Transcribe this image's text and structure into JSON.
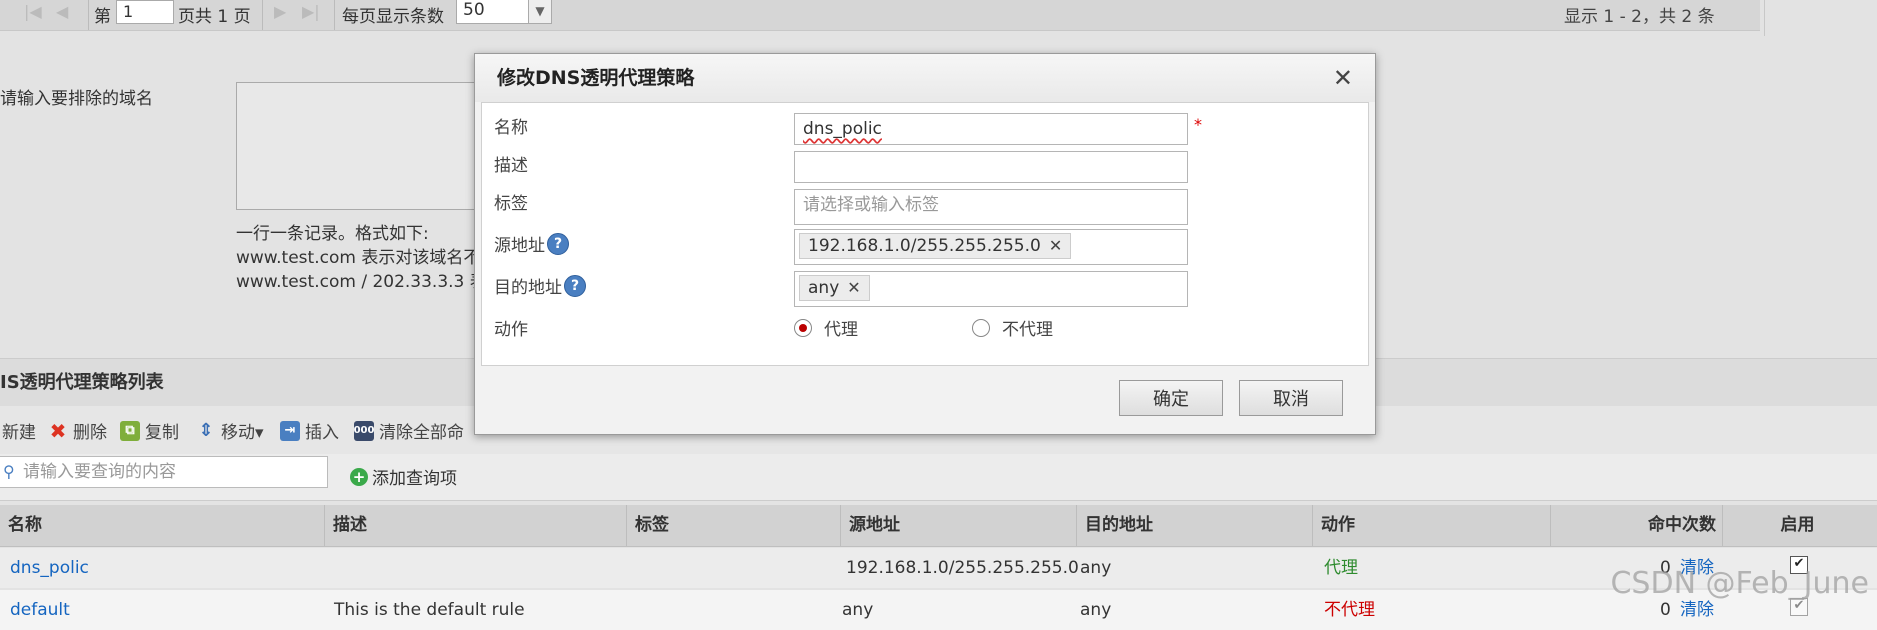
{
  "pager": {
    "first_icon": "first-page-icon",
    "prev_icon": "prev-page-icon",
    "page_prefix": "第",
    "page_value": "1",
    "page_suffix": "页共 1 页",
    "next_icon": "next-page-icon",
    "last_icon": "last-page-icon",
    "per_page_label": "每页显示条数",
    "per_page_value": "50",
    "summary": "显示 1 - 2，共 2 条"
  },
  "exclude": {
    "label": "请输入要排除的域名",
    "help_line1": "一行一条记录。格式如下:",
    "help_line2": "www.test.com 表示对该域名不",
    "help_line3": "www.test.com / 202.33.3.3 表"
  },
  "list": {
    "title": "IS透明代理策略列表",
    "toolbar": [
      {
        "name": "new",
        "label": "新建",
        "icon": "new-icon"
      },
      {
        "name": "delete",
        "label": "删除",
        "icon": "delete-icon"
      },
      {
        "name": "copy",
        "label": "复制",
        "icon": "copy-icon"
      },
      {
        "name": "move",
        "label": "移动▾",
        "icon": "move-icon"
      },
      {
        "name": "insert",
        "label": "插入",
        "icon": "insert-icon"
      },
      {
        "name": "clear-hits",
        "label": "清除全部命",
        "icon": "counter-reset-icon"
      }
    ],
    "search_placeholder": "请输入要查询的内容",
    "add_query_label": "添加查询项",
    "columns": [
      "名称",
      "描述",
      "标签",
      "源地址",
      "目的地址",
      "动作",
      "命中次数",
      "启用"
    ],
    "rows": [
      {
        "name": "dns_polic",
        "desc": "",
        "tag": "",
        "src": "192.168.1.0/255.255.255.0",
        "dst": "any",
        "action": "代理",
        "hits": "0",
        "clear": "清除",
        "enabled": true
      },
      {
        "name": "default",
        "desc": "This is the default rule",
        "tag": "",
        "src": "any",
        "dst": "any",
        "action": "不代理",
        "hits": "0",
        "clear": "清除",
        "enabled": true
      }
    ]
  },
  "dialog": {
    "title": "修改DNS透明代理策略",
    "close_icon": "close-icon",
    "fields": {
      "name_label": "名称",
      "name_value": "dns_polic",
      "required_mark": "*",
      "desc_label": "描述",
      "desc_value": "",
      "tag_label": "标签",
      "tag_placeholder": "请选择或输入标签",
      "src_label": "源地址",
      "src_tag": "192.168.1.0/255.255.255.0",
      "dst_label": "目的地址",
      "dst_tag": "any",
      "action_label": "动作",
      "action_proxy": "代理",
      "action_noproxy": "不代理",
      "action_selected": "代理"
    },
    "ok_label": "确定",
    "cancel_label": "取消"
  },
  "watermark": "CSDN @Feb_June",
  "colors": {
    "link": "#1565c0",
    "proxy": "#2e8b2e",
    "noproxy": "#cc0000",
    "help": "#4a7fc1"
  }
}
